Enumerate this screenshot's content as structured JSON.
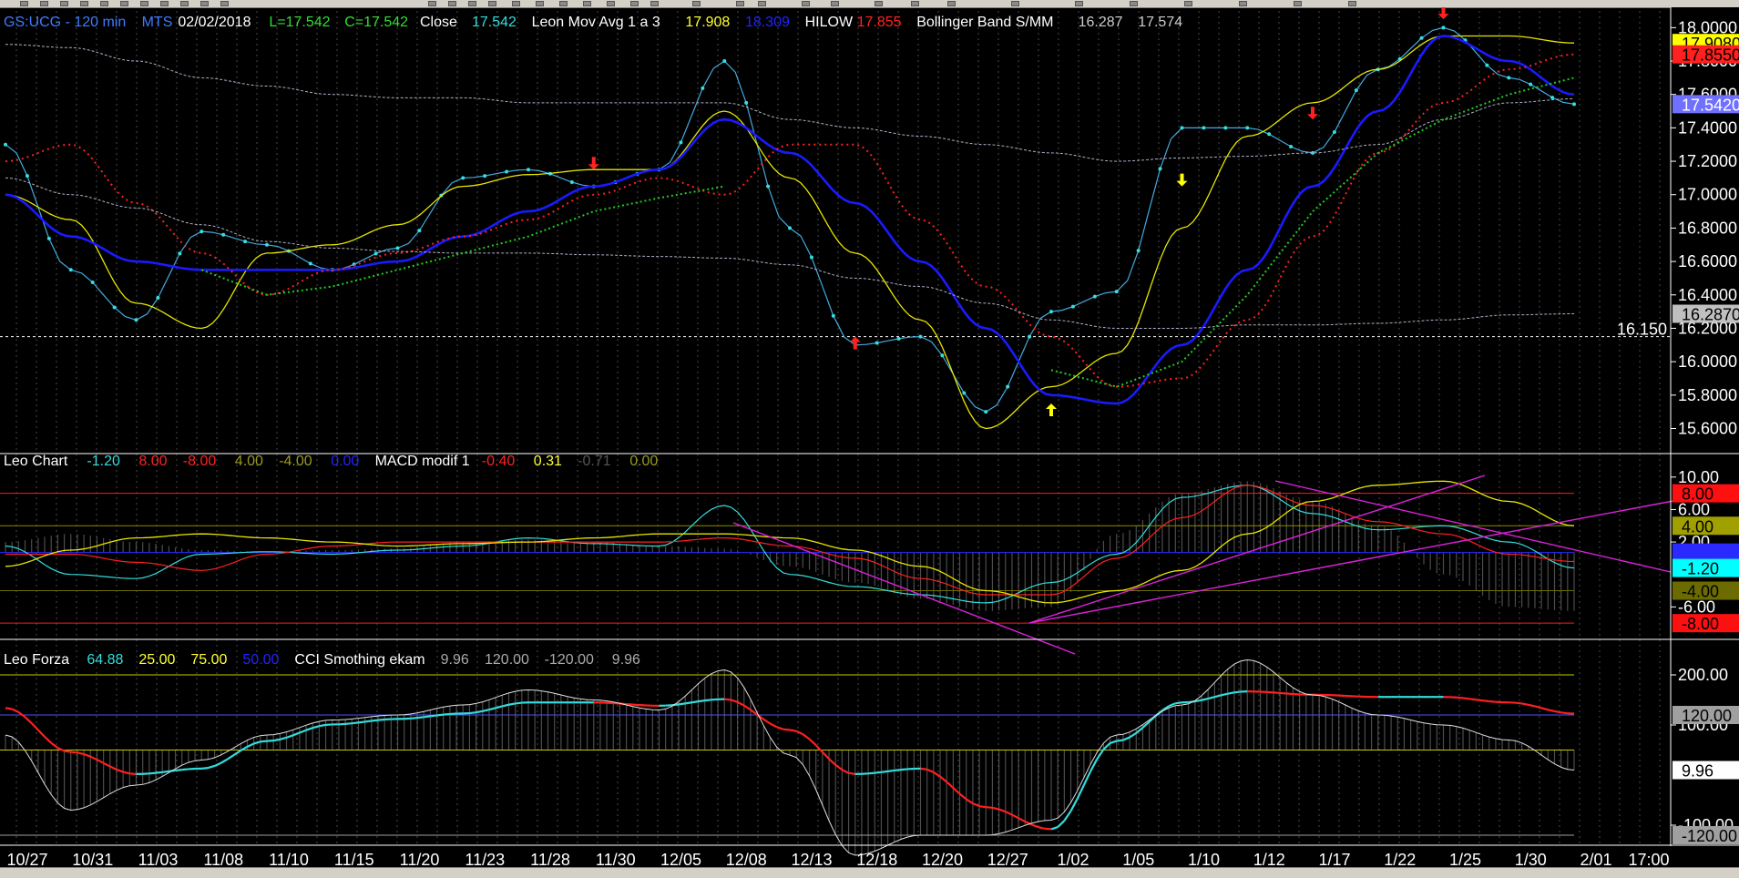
{
  "panels": {
    "price": {
      "header": [
        {
          "text": "GS:UCG - 120 min",
          "color": "#3f7bff"
        },
        {
          "text": "MTS",
          "color": "#3f7bff"
        },
        {
          "text": "02/02/2018",
          "color": "#ffffff"
        },
        {
          "text": "L=17.542",
          "color": "#33dd33"
        },
        {
          "text": "C=17.542",
          "color": "#33dd33"
        },
        {
          "text": "Close",
          "color": "#ffffff"
        },
        {
          "text": "17.542",
          "color": "#33dddd"
        },
        {
          "text": "Leon Mov Avg 1 a 3",
          "color": "#ffffff"
        },
        {
          "text": "17.908",
          "color": "#ffff33"
        },
        {
          "text": "18.309",
          "color": "#2222ff"
        },
        {
          "text": "HILOW",
          "color": "#ffffff"
        },
        {
          "text": "17.855",
          "color": "#ff2222"
        },
        {
          "text": "Bollinger Band S/MM",
          "color": "#ffffff"
        },
        {
          "text": "16.287",
          "color": "#cccccc"
        },
        {
          "text": "17.574",
          "color": "#cccccc"
        }
      ],
      "axis_labels": [
        "18.0000",
        "17.8000",
        "17.6000",
        "17.4000",
        "17.2000",
        "17.0000",
        "16.8000",
        "16.6000",
        "16.4000",
        "16.2000",
        "16.0000",
        "15.8000",
        "15.6000"
      ],
      "value_tags": [
        {
          "text": "17.9080",
          "value": 17.908,
          "bg": "#ffff00",
          "fg": "#000000"
        },
        {
          "text": "17.8550",
          "value": 17.84,
          "bg": "#ff2020",
          "fg": "#000000"
        },
        {
          "text": "17.5420",
          "value": 17.542,
          "bg": "#7070ff",
          "fg": "#ffffff"
        },
        {
          "text": "16.2870",
          "value": 16.287,
          "bg": "#c0c0c0",
          "fg": "#000000"
        }
      ],
      "hline": {
        "text": "16.150",
        "value": 16.15
      }
    },
    "leo_chart": {
      "header": [
        {
          "text": "Leo Chart",
          "color": "#ffffff"
        },
        {
          "text": "-1.20",
          "color": "#33dddd"
        },
        {
          "text": "8.00",
          "color": "#ff2222"
        },
        {
          "text": "-8.00",
          "color": "#ff2222"
        },
        {
          "text": "4.00",
          "color": "#999922"
        },
        {
          "text": "-4.00",
          "color": "#999922"
        },
        {
          "text": "0.00",
          "color": "#2222ff"
        },
        {
          "text": "MACD modif 1",
          "color": "#ffffff"
        },
        {
          "text": "-0.40",
          "color": "#ff2222"
        },
        {
          "text": "0.31",
          "color": "#ffff33"
        },
        {
          "text": "-0.71",
          "color": "#555555"
        },
        {
          "text": "0.00",
          "color": "#999922"
        }
      ],
      "axis_labels": [
        "10.00",
        "6.00",
        "2.00",
        "-6.00"
      ],
      "value_tags": [
        {
          "text": "8.00",
          "value": 8,
          "bg": "#ff1010",
          "fg": "#000000"
        },
        {
          "text": "4.00",
          "value": 4,
          "bg": "#a0a000",
          "fg": "#000000"
        },
        {
          "text": "0.00",
          "value": 0.7,
          "bg": "#2a2aff",
          "fg": "#2a2aff"
        },
        {
          "text": "-1.20",
          "value": -1.2,
          "bg": "#00ffff",
          "fg": "#000000"
        },
        {
          "text": "-4.00",
          "value": -4,
          "bg": "#6b6b00",
          "fg": "#000000"
        },
        {
          "text": "-8.00",
          "value": -8,
          "bg": "#ff1010",
          "fg": "#000000"
        }
      ]
    },
    "leo_forza": {
      "header": [
        {
          "text": "Leo Forza",
          "color": "#ffffff"
        },
        {
          "text": "64.88",
          "color": "#33dddd"
        },
        {
          "text": "25.00",
          "color": "#ffff33"
        },
        {
          "text": "75.00",
          "color": "#ffff33"
        },
        {
          "text": "50.00",
          "color": "#2222ff"
        },
        {
          "text": "CCI Smothing ekam",
          "color": "#ffffff"
        },
        {
          "text": "9.96",
          "color": "#aaaaaa"
        },
        {
          "text": "120.00",
          "color": "#aaaaaa"
        },
        {
          "text": "-120.00",
          "color": "#aaaaaa"
        },
        {
          "text": "9.96",
          "color": "#aaaaaa"
        }
      ],
      "axis_labels": [
        "200.00",
        "100.00",
        "-100.00"
      ],
      "value_tags": [
        {
          "text": "120.00",
          "value": 120,
          "bg": "#a0a0a0",
          "fg": "#000000"
        },
        {
          "text": "9.96",
          "value": 9.96,
          "bg": "#ffffff",
          "fg": "#000000"
        },
        {
          "text": "-120.00",
          "value": -120,
          "bg": "#a0a0a0",
          "fg": "#000000"
        }
      ]
    }
  },
  "x_labels": [
    "10/27",
    "10/31",
    "11/03",
    "11/08",
    "11/10",
    "11/15",
    "11/20",
    "11/23",
    "11/28",
    "11/30",
    "12/05",
    "12/08",
    "12/13",
    "12/18",
    "12/20",
    "12/27",
    "1/02",
    "1/05",
    "1/10",
    "1/12",
    "1/17",
    "1/22",
    "1/25",
    "1/30",
    "2/01",
    "17:00"
  ],
  "chart_data": {
    "type": "line",
    "title": "GS:UCG - 120 min",
    "x": [
      "10/27",
      "10/31",
      "11/03",
      "11/08",
      "11/10",
      "11/15",
      "11/20",
      "11/23",
      "11/28",
      "11/30",
      "12/05",
      "12/08",
      "12/13",
      "12/18",
      "12/20",
      "12/27",
      "1/02",
      "1/05",
      "1/10",
      "1/12",
      "1/17",
      "1/22",
      "1/25",
      "1/30",
      "2/01"
    ],
    "price_series": [
      {
        "name": "Close",
        "values": [
          17.3,
          16.55,
          16.25,
          16.78,
          16.7,
          16.55,
          16.68,
          17.1,
          17.15,
          17.05,
          17.15,
          17.8,
          16.8,
          16.1,
          16.15,
          15.7,
          16.3,
          16.42,
          17.4,
          17.4,
          17.25,
          17.75,
          18.0,
          17.7,
          17.542
        ]
      },
      {
        "name": "17.908",
        "values": [
          17.0,
          16.85,
          16.35,
          16.2,
          16.65,
          16.7,
          16.82,
          17.05,
          17.12,
          17.15,
          17.15,
          17.5,
          17.1,
          16.65,
          16.25,
          15.6,
          15.85,
          16.05,
          16.8,
          17.35,
          17.55,
          17.75,
          17.95,
          17.95,
          17.908
        ]
      },
      {
        "name": "18.309",
        "values": [
          17.0,
          16.75,
          16.6,
          16.55,
          16.55,
          16.55,
          16.6,
          16.75,
          16.9,
          17.05,
          17.15,
          17.45,
          17.25,
          16.95,
          16.6,
          16.2,
          15.8,
          15.75,
          16.1,
          16.55,
          17.05,
          17.5,
          17.95,
          17.8,
          17.6
        ]
      },
      {
        "name": "17.855",
        "values": [
          17.2,
          17.3,
          16.95,
          16.65,
          16.4,
          16.55,
          16.65,
          16.75,
          16.85,
          17.0,
          17.1,
          17.0,
          17.3,
          17.3,
          16.85,
          16.45,
          16.15,
          15.85,
          15.9,
          16.25,
          16.75,
          17.25,
          17.55,
          17.75,
          17.84
        ]
      },
      {
        "name": "16.287",
        "values": [
          17.1,
          17.0,
          16.92,
          16.82,
          16.72,
          16.68,
          16.66,
          16.65,
          16.65,
          16.64,
          16.63,
          16.62,
          16.58,
          16.5,
          16.45,
          16.35,
          16.25,
          16.2,
          16.2,
          16.22,
          16.22,
          16.23,
          16.25,
          16.28,
          16.287
        ]
      },
      {
        "name": "17.574",
        "values": [
          17.9,
          17.88,
          17.8,
          17.7,
          17.65,
          17.6,
          17.58,
          17.58,
          17.55,
          17.55,
          17.55,
          17.55,
          17.45,
          17.4,
          17.35,
          17.3,
          17.25,
          17.2,
          17.22,
          17.23,
          17.25,
          17.3,
          17.45,
          17.55,
          17.574
        ]
      }
    ],
    "leo_series": [
      {
        "name": "-1.20",
        "values": [
          1.5,
          -2.0,
          -2.5,
          0.5,
          0.8,
          0.5,
          1.0,
          1.5,
          2.5,
          1.8,
          1.5,
          6.5,
          -2.0,
          -3.5,
          -4.5,
          -5.5,
          -3.0,
          0.5,
          7.5,
          9.0,
          5.5,
          3.5,
          4.0,
          2.0,
          -1.2
        ]
      },
      {
        "name": "-0.40",
        "values": [
          0.5,
          0.5,
          -0.5,
          -1.5,
          0.5,
          1.5,
          2.0,
          2.0,
          2.0,
          2.0,
          2.0,
          2.5,
          1.5,
          0.0,
          -2.5,
          -4.5,
          -4.5,
          0.0,
          5.0,
          9.0,
          6.5,
          4.5,
          3.0,
          0.5,
          -0.4
        ]
      },
      {
        "name": "0.31",
        "values": [
          -1.0,
          1.0,
          2.5,
          3.0,
          2.5,
          2.0,
          1.5,
          1.8,
          2.0,
          2.5,
          3.0,
          3.0,
          2.5,
          1.0,
          -1.0,
          -4.0,
          -5.5,
          -4.0,
          -1.5,
          3.0,
          7.0,
          9.0,
          9.5,
          7.0,
          4.0
        ]
      }
    ],
    "forza_series": [
      {
        "name": "64.88",
        "values": [
          70,
          30,
          10,
          15,
          40,
          55,
          60,
          65,
          75,
          75,
          72,
          78,
          50,
          10,
          15,
          -20,
          -40,
          40,
          75,
          85,
          82,
          80,
          80,
          75,
          64.88
        ]
      },
      {
        "name": "9.96",
        "values": [
          80,
          -70,
          -20,
          30,
          80,
          110,
          120,
          140,
          170,
          150,
          130,
          210,
          40,
          -160,
          -120,
          -120,
          -90,
          80,
          140,
          230,
          160,
          120,
          100,
          70,
          9.96
        ]
      }
    ],
    "ylim": [
      15.45,
      18.1
    ]
  }
}
